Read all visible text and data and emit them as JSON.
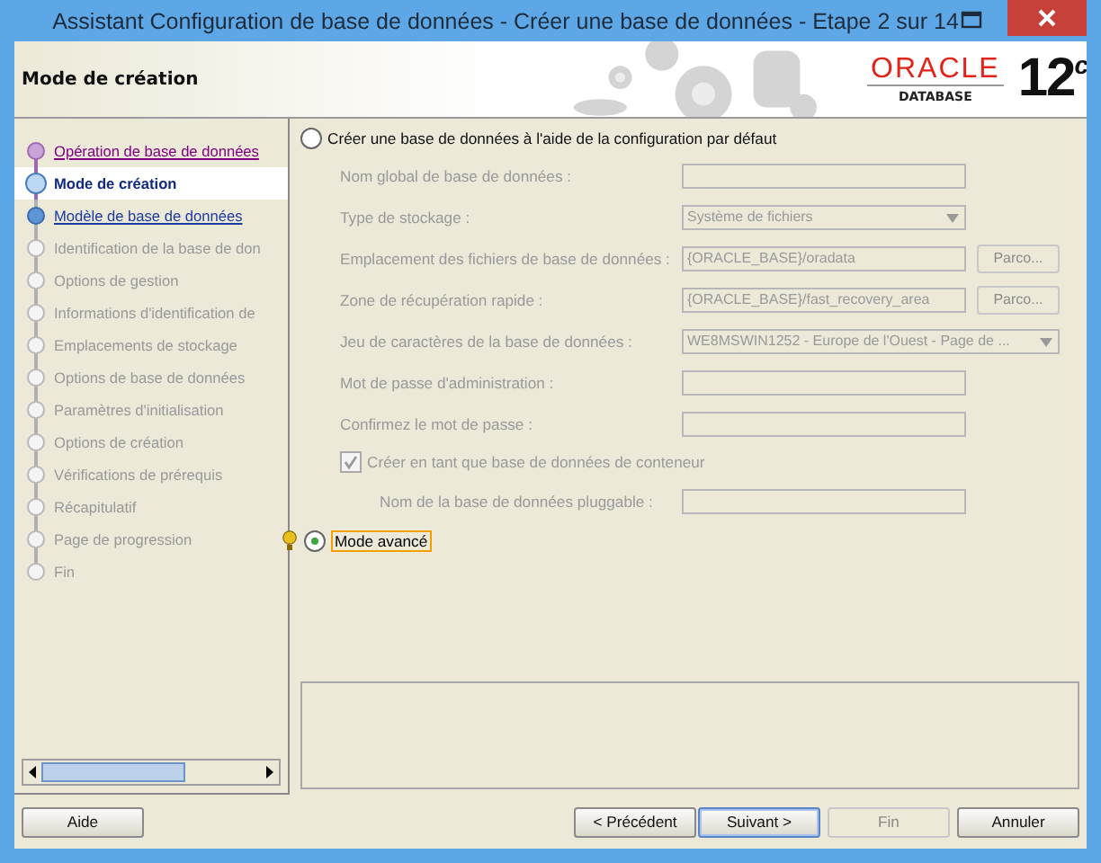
{
  "window": {
    "title": "Assistant Configuration de base de données - Créer une base de données - Etape 2 sur 14"
  },
  "header": {
    "title": "Mode de création",
    "brand": "ORACLE",
    "product": "DATABASE",
    "version": "12",
    "version_suffix": "c"
  },
  "steps": [
    {
      "label": "Opération de base de données",
      "kind": "visited",
      "selected": false
    },
    {
      "label": "Mode de création",
      "kind": "current",
      "selected": true
    },
    {
      "label": "Modèle de base de données",
      "kind": "next",
      "selected": false
    },
    {
      "label": "Identification de la base de don",
      "kind": "pending",
      "selected": false
    },
    {
      "label": "Options de gestion",
      "kind": "pending",
      "selected": false
    },
    {
      "label": "Informations d'identification de",
      "kind": "pending",
      "selected": false
    },
    {
      "label": "Emplacements de stockage",
      "kind": "pending",
      "selected": false
    },
    {
      "label": "Options de base de données",
      "kind": "pending",
      "selected": false
    },
    {
      "label": "Paramètres d'initialisation",
      "kind": "pending",
      "selected": false
    },
    {
      "label": "Options de création",
      "kind": "pending",
      "selected": false
    },
    {
      "label": "Vérifications de prérequis",
      "kind": "pending",
      "selected": false
    },
    {
      "label": "Récapitulatif",
      "kind": "pending",
      "selected": false
    },
    {
      "label": "Page de progression",
      "kind": "pending",
      "selected": false
    },
    {
      "label": "Fin",
      "kind": "pending",
      "selected": false
    }
  ],
  "default_option": {
    "label": "Créer une base de données à l'aide de la configuration par défaut",
    "selected": false
  },
  "fields": [
    {
      "label": "Nom global de base de données :",
      "kind": "text",
      "disabled": true
    },
    {
      "label": "Type de stockage :",
      "kind": "select",
      "value": "Système de fichiers",
      "disabled": true
    },
    {
      "label": "Emplacement des fichiers de base de données :",
      "kind": "browse",
      "value": "{ORACLE_BASE}/oradata",
      "button": "Parco...",
      "disabled": true
    },
    {
      "label": "Zone de récupération rapide :",
      "kind": "browse",
      "value": "{ORACLE_BASE}/fast_recovery_area",
      "button": "Parco...",
      "disabled": true
    },
    {
      "label": "Jeu de caractères de la base de données :",
      "kind": "wide-select",
      "value": "WE8MSWIN1252 - Europe de l'Ouest - Page de ...",
      "disabled": true
    },
    {
      "label": "Mot de passe d'administration :",
      "kind": "text",
      "disabled": true
    },
    {
      "label": "Confirmez le mot de passe :",
      "kind": "text",
      "disabled": true
    }
  ],
  "container": {
    "label": "Créer en tant que base de données de conteneur",
    "checked": true,
    "disabled": true
  },
  "pluggable": {
    "label": "Nom de la base de données pluggable :",
    "disabled": true
  },
  "advanced_option": {
    "label": "Mode avancé",
    "selected": true
  },
  "buttons": {
    "help": {
      "label": "Aide",
      "disabled": false
    },
    "nav": [
      {
        "label": "< Précédent",
        "disabled": false,
        "default": false
      },
      {
        "label": "Suivant >",
        "disabled": false,
        "default": true
      },
      {
        "label": "Fin",
        "disabled": true,
        "default": false
      },
      {
        "label": "Annuler",
        "disabled": false,
        "default": false
      }
    ]
  }
}
